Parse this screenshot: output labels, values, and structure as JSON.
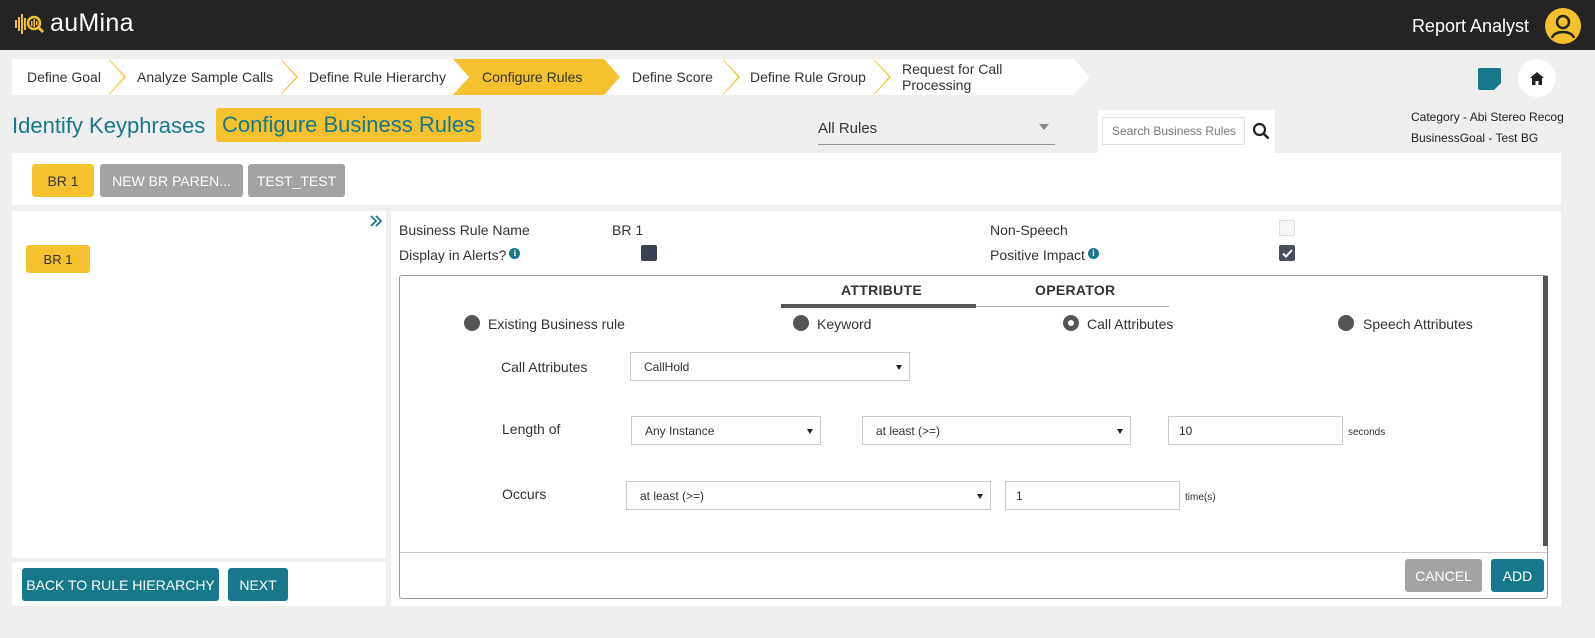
{
  "app": {
    "name": "auMina",
    "user_role": "Report Analyst"
  },
  "wizard": {
    "steps": [
      {
        "label": "Define Goal",
        "active": false
      },
      {
        "label": "Analyze Sample Calls",
        "active": false
      },
      {
        "label": "Define Rule Hierarchy",
        "active": false
      },
      {
        "label": "Configure Rules",
        "active": true
      },
      {
        "label": "Define Score",
        "active": false
      },
      {
        "label": "Define Rule Group",
        "active": false
      },
      {
        "label": "Request for Call Processing",
        "active": false
      }
    ]
  },
  "header": {
    "title_primary": "Identify Keyphrases",
    "title_secondary": "Configure Business Rules",
    "rules_filter": "All Rules",
    "search_placeholder": "Search Business Rules",
    "category": "Category - Abi Stereo Recog",
    "business_goal": "BusinessGoal - Test BG"
  },
  "rule_tabs": [
    "BR 1",
    "NEW BR PAREN...",
    "TEST_TEST"
  ],
  "tree": {
    "items": [
      "BR 1"
    ]
  },
  "footer_buttons": {
    "back": "BACK TO RULE HIERARCHY",
    "next": "NEXT"
  },
  "rule": {
    "name_label": "Business Rule Name",
    "name_value": "BR 1",
    "alerts_label": "Display in Alerts?",
    "alerts_checked": true,
    "non_speech_label": "Non-Speech",
    "non_speech_checked": false,
    "positive_impact_label": "Positive Impact",
    "positive_impact_checked": true
  },
  "editor": {
    "tabs": [
      "ATTRIBUTE",
      "OPERATOR"
    ],
    "active_tab": "ATTRIBUTE",
    "radios": [
      {
        "label": "Existing Business rule",
        "selected": false
      },
      {
        "label": "Keyword",
        "selected": false
      },
      {
        "label": "Call Attributes",
        "selected": true
      },
      {
        "label": "Speech Attributes",
        "selected": false
      }
    ],
    "call_attributes_label": "Call Attributes",
    "call_attributes_value": "CallHold",
    "length_label": "Length of",
    "length_instance": "Any Instance",
    "length_operator": "at least (>=)",
    "length_value": "10",
    "length_unit": "seconds",
    "occurs_label": "Occurs",
    "occurs_operator": "at least (>=)",
    "occurs_value": "1",
    "occurs_unit": "time(s)",
    "cancel": "CANCEL",
    "add": "ADD"
  },
  "colors": {
    "teal": "#17788b",
    "yellow": "#f6c12f",
    "topbar": "#242424"
  }
}
